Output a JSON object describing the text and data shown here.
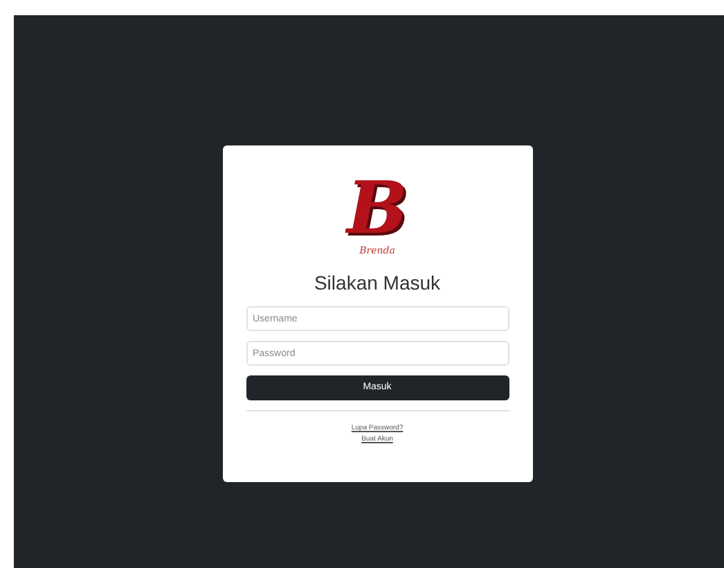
{
  "logo": {
    "letter": "B",
    "name": "Brenda"
  },
  "title": "Silakan Masuk",
  "fields": [
    {
      "placeholder": "Username"
    },
    {
      "placeholder": "Password"
    }
  ],
  "submit": "Masuk",
  "links": [
    "Lupa Password?",
    "Buat Akun"
  ]
}
